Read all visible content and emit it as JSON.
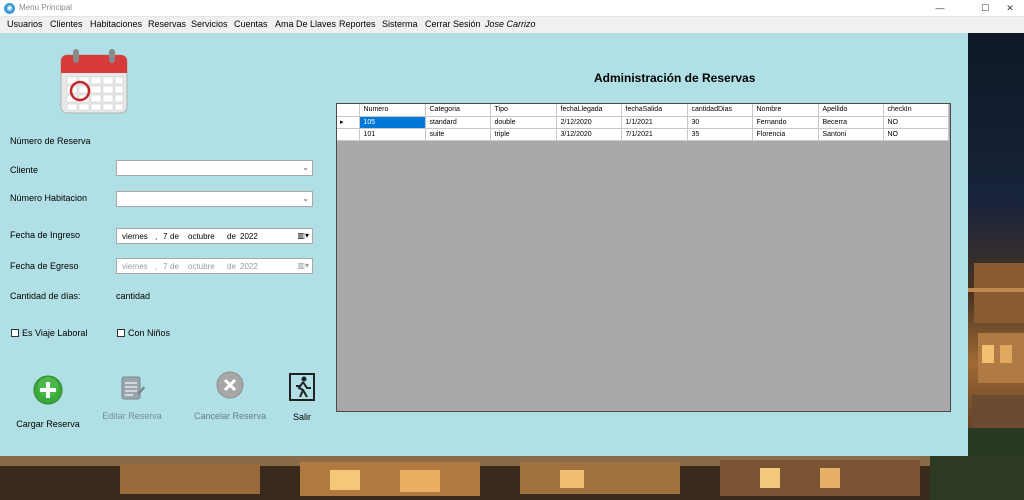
{
  "window": {
    "title": "Menu Principal",
    "minimize": "—",
    "maximize": "☐",
    "close": "✕"
  },
  "menu": [
    "Usuarios",
    "Clientes",
    "Habitaciones",
    "Reservas",
    "Servicios",
    "Cuentas",
    "Ama De Llaves",
    "Reportes",
    "Sisterma",
    "Cerrar Sesión",
    "Jose Carrizo"
  ],
  "form": {
    "numero_reserva_label": "Número de Reserva",
    "cliente_label": "Cliente",
    "cliente_value": "",
    "habitacion_label": "Número Habitacion",
    "habitacion_value": "",
    "ingreso_label": "Fecha de Ingreso",
    "ingreso": {
      "day_name": "viernes",
      "day": "7",
      "de1": "de",
      "month": "octubre",
      "de2": "de",
      "year": "2022"
    },
    "egreso_label": "Fecha de Egreso",
    "egreso": {
      "day_name": "viernes",
      "day": "7",
      "de1": "de",
      "month": "octubre",
      "de2": "de",
      "year": "2022"
    },
    "dias_label": "Cantidad de días:",
    "dias_value": "cantidad",
    "viaje_laboral_label": "Es Viaje Laboral",
    "con_ninos_label": "Con Niños"
  },
  "actions": {
    "cargar": "Cargar Reserva",
    "editar": "Editar Reserva",
    "cancelar": "Cancelar Reserva",
    "salir": "Salir"
  },
  "heading": "Administración de Reservas",
  "grid": {
    "columns": [
      "Numero",
      "Categoria",
      "Tipo",
      "fechaLlegada",
      "fechaSalida",
      "cantidadDias",
      "Nombre",
      "Apellido",
      "checkIn"
    ],
    "rows": [
      [
        "105",
        "standard",
        "double",
        "2/12/2020",
        "1/1/2021",
        "30",
        "Fernando",
        "Becerra",
        "NO"
      ],
      [
        "101",
        "suite",
        "triple",
        "3/12/2020",
        "7/1/2021",
        "35",
        "Florencia",
        "Santoni",
        "NO"
      ]
    ],
    "current_row_marker": "▸"
  },
  "colors": {
    "panel": "#b0e0e6",
    "grid_background": "#a9a9a9",
    "selection": "#0078d7",
    "add_green": "#3aa83a"
  }
}
